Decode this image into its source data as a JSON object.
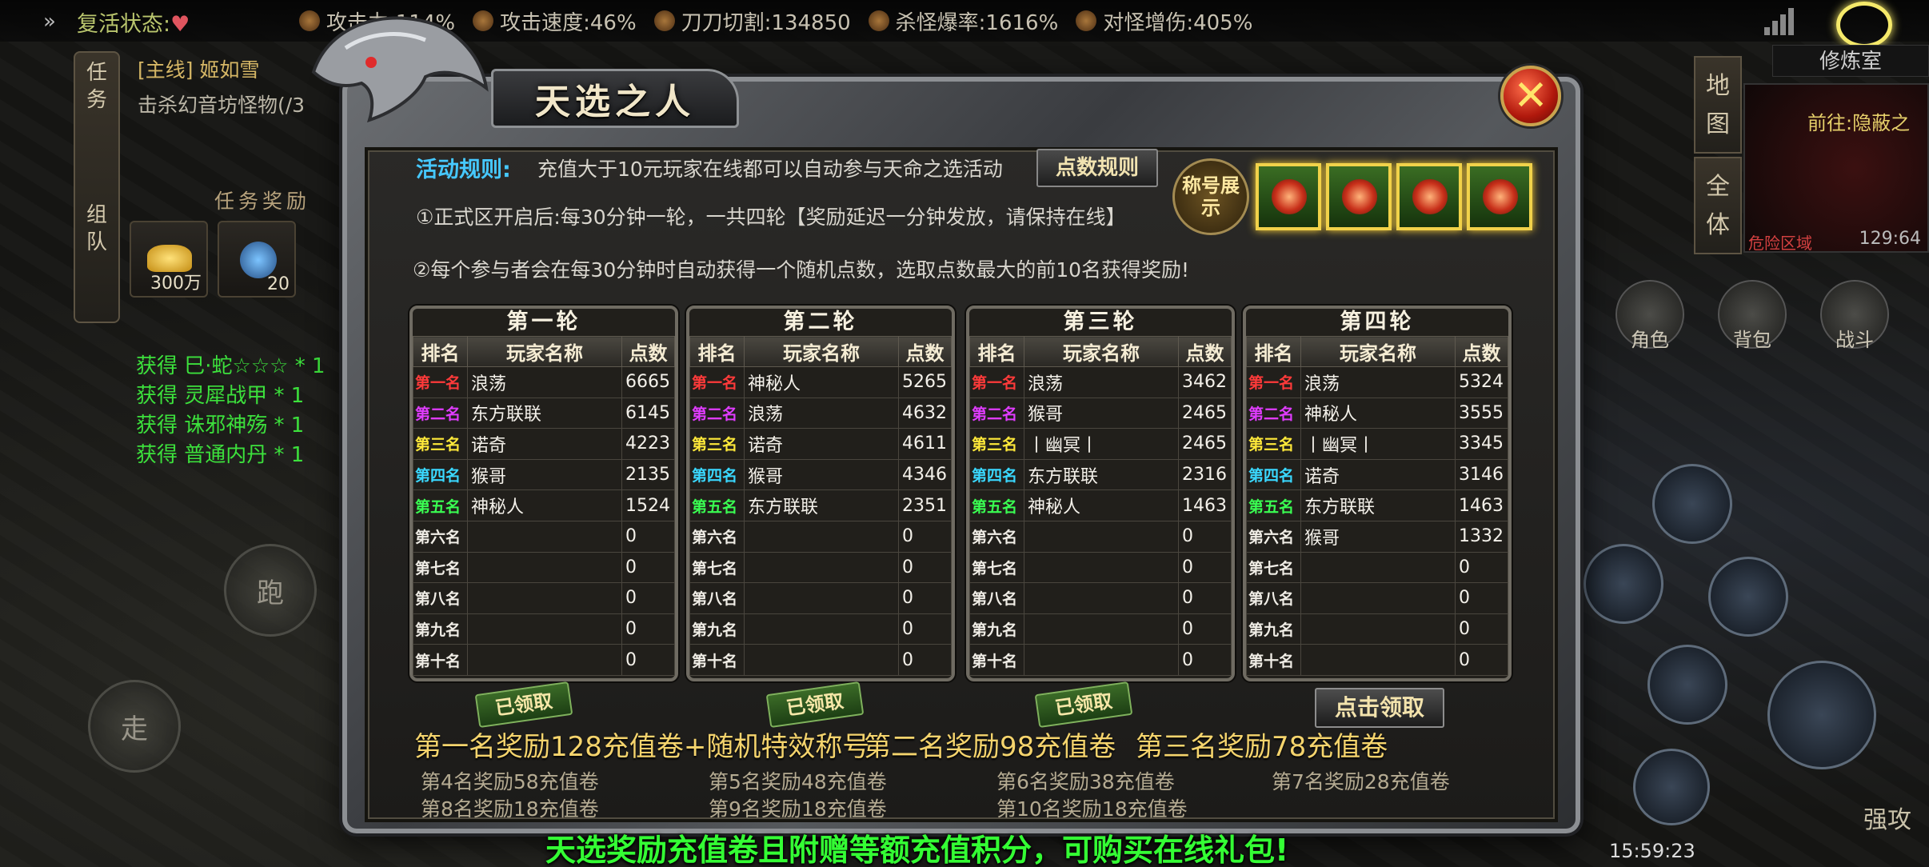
{
  "topbar": {
    "revive_label": "复活状态:",
    "stats": [
      {
        "icon": "attack-icon",
        "label": "攻击力:114%"
      },
      {
        "icon": "speed-icon",
        "label": "攻击速度:46%"
      },
      {
        "icon": "skull-icon",
        "label": "刀刀切割:134850"
      },
      {
        "icon": "crit-icon",
        "label": "杀怪爆率:1616%"
      },
      {
        "icon": "damage-icon",
        "label": "对怪增伤:405%"
      }
    ]
  },
  "quest": {
    "tabs": [
      "任",
      "务",
      "组",
      "队"
    ],
    "title": "[主线] 姬如雪",
    "desc": "击杀幻音坊怪物(/3",
    "reward_title": "任务奖励",
    "rewards": [
      {
        "icon": "gold-ingot-icon",
        "count": "300万"
      },
      {
        "icon": "gem-icon",
        "count": "20"
      }
    ]
  },
  "loot_log": [
    "获得 巳·蛇☆☆☆ * 1",
    "获得 灵犀战甲 * 1",
    "获得 诛邪神殇 * 1",
    "获得 普通内丹 * 1"
  ],
  "controls": {
    "run": "跑",
    "walk": "走",
    "strong_attack": "强攻"
  },
  "minimap": {
    "label": "修炼室",
    "goto": "前往:隐蔽之",
    "zone": "危险区域",
    "coord": "129:64",
    "tabs": [
      "地图",
      "全体"
    ]
  },
  "side_buttons": [
    "角色",
    "背包",
    "战斗"
  ],
  "clock": "15:59:23",
  "dialog": {
    "title": "天选之人",
    "close": "✕",
    "rule_label": "活动规则:",
    "rule_main": "充值大于10元玩家在线都可以自动参与天命之选活动",
    "points_rule_btn": "点数规则",
    "rule_1": "①正式区开启后:每30分钟一轮，一共四轮【奖励延迟一分钟发放，请保持在线】",
    "rule_2": "②每个参与者会在每30分钟时自动获得一个随机点数，选取点数最大的前10名获得奖励!",
    "title_show": "称号展示",
    "headers": [
      "排名",
      "玩家名称",
      "点数"
    ],
    "ranks": [
      "第一名",
      "第二名",
      "第三名",
      "第四名",
      "第五名",
      "第六名",
      "第七名",
      "第八名",
      "第九名",
      "第十名"
    ],
    "rounds": [
      {
        "title": "第一轮",
        "rows": [
          [
            "浪荡",
            "6665"
          ],
          [
            "东方联联",
            "6145"
          ],
          [
            "诺奇",
            "4223"
          ],
          [
            "猴哥",
            "2135"
          ],
          [
            "神秘人",
            "1524"
          ],
          [
            "",
            "0"
          ],
          [
            "",
            "0"
          ],
          [
            "",
            "0"
          ],
          [
            "",
            "0"
          ],
          [
            "",
            "0"
          ]
        ]
      },
      {
        "title": "第二轮",
        "rows": [
          [
            "神秘人",
            "5265"
          ],
          [
            "浪荡",
            "4632"
          ],
          [
            "诺奇",
            "4611"
          ],
          [
            "猴哥",
            "4346"
          ],
          [
            "东方联联",
            "2351"
          ],
          [
            "",
            "0"
          ],
          [
            "",
            "0"
          ],
          [
            "",
            "0"
          ],
          [
            "",
            "0"
          ],
          [
            "",
            "0"
          ]
        ]
      },
      {
        "title": "第三轮",
        "rows": [
          [
            "浪荡",
            "3462"
          ],
          [
            "猴哥",
            "2465"
          ],
          [
            "丨幽冥丨",
            "2465"
          ],
          [
            "东方联联",
            "2316"
          ],
          [
            "神秘人",
            "1463"
          ],
          [
            "",
            "0"
          ],
          [
            "",
            "0"
          ],
          [
            "",
            "0"
          ],
          [
            "",
            "0"
          ],
          [
            "",
            "0"
          ]
        ]
      },
      {
        "title": "第四轮",
        "rows": [
          [
            "浪荡",
            "5324"
          ],
          [
            "神秘人",
            "3555"
          ],
          [
            "丨幽冥丨",
            "3345"
          ],
          [
            "诺奇",
            "3146"
          ],
          [
            "东方联联",
            "1463"
          ],
          [
            "猴哥",
            "1332"
          ],
          [
            "",
            "0"
          ],
          [
            "",
            "0"
          ],
          [
            "",
            "0"
          ],
          [
            "",
            "0"
          ]
        ]
      }
    ],
    "claimed": "已领取",
    "claim_btn": "点击领取",
    "reward_1": "第一名奖励128充值卷+随机特效称号",
    "reward_2": "第二名奖励98充值卷",
    "reward_3": "第三名奖励78充值卷",
    "small_rewards": [
      "第4名奖励58充值卷",
      "第5名奖励48充值卷",
      "第6名奖励38充值卷",
      "第7名奖励28充值卷",
      "第8名奖励18充值卷",
      "第9名奖励18充值卷",
      "第10名奖励18充值卷"
    ]
  },
  "banner": "天选奖励充值卷且附赠等额充值积分，可购买在线礼包!"
}
